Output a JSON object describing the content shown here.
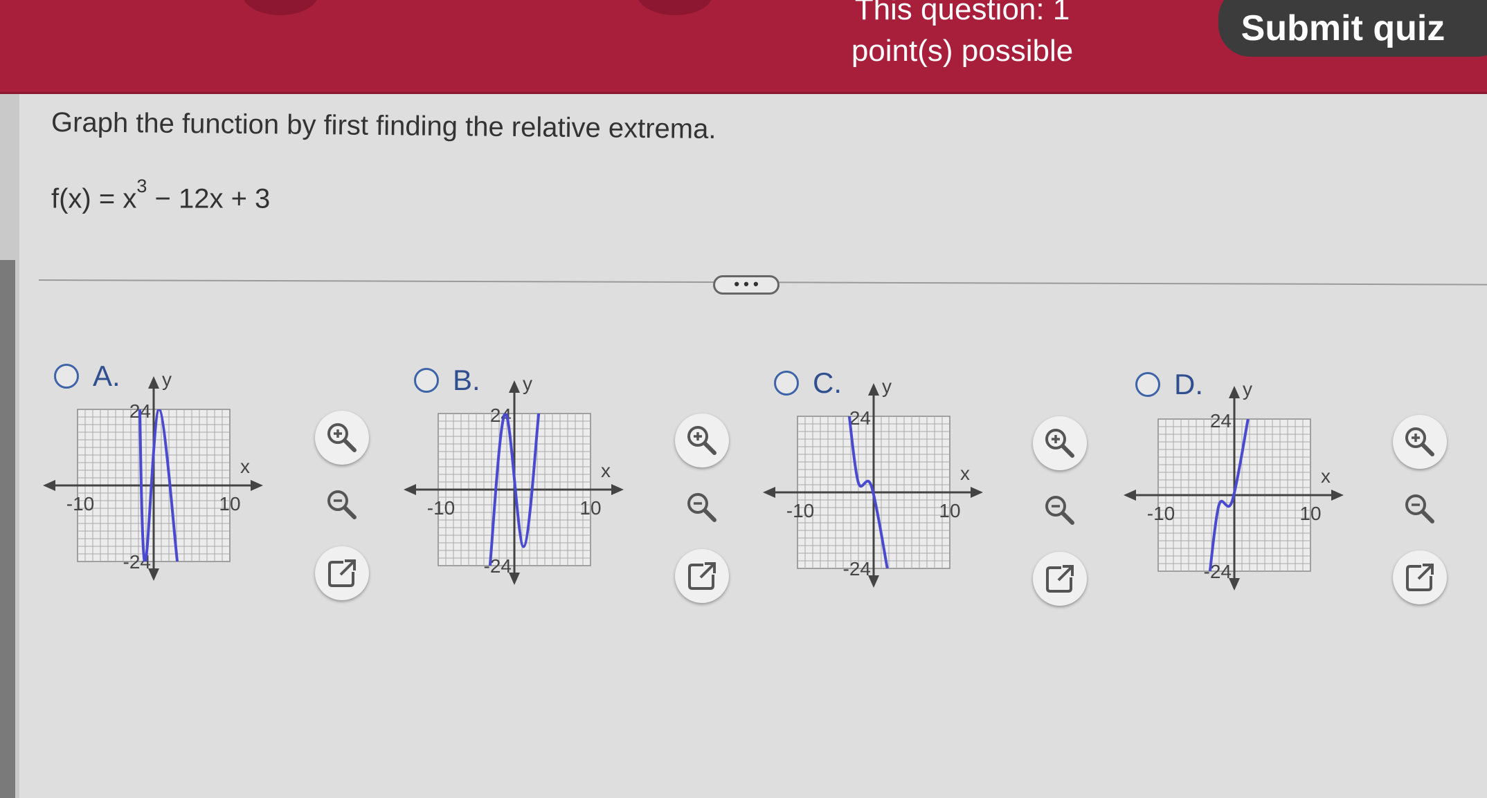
{
  "header": {
    "question_label": "This question: 1",
    "points_label": "point(s) possible",
    "submit_label": "Submit quiz"
  },
  "question": {
    "instruction": "Graph the function by first finding the relative extrema.",
    "formula_prefix": "f(x) = x",
    "formula_exponent": "3",
    "formula_suffix": " − 12x + 3"
  },
  "more_button": {
    "label": "• • •"
  },
  "options": [
    {
      "label": "A.",
      "curve": [
        [
          -2,
          50
        ],
        [
          -1.2,
          -24
        ],
        [
          0.7,
          24
        ],
        [
          3.1,
          -24
        ]
      ]
    },
    {
      "label": "B.",
      "curve": [
        [
          -3.2,
          -24
        ],
        [
          -1.2,
          24
        ],
        [
          1.2,
          -18
        ],
        [
          3.2,
          24
        ]
      ]
    },
    {
      "label": "C.",
      "curve": [
        [
          -3.2,
          24
        ],
        [
          -2,
          3
        ],
        [
          -0.3,
          2
        ],
        [
          1.8,
          -24
        ]
      ]
    },
    {
      "label": "D.",
      "curve": [
        [
          -3.2,
          -24
        ],
        [
          -2,
          -3
        ],
        [
          -0.3,
          -2
        ],
        [
          1.8,
          24
        ]
      ]
    }
  ],
  "graph_axes": {
    "x_label": "x",
    "y_label": "y",
    "x_min_label": "-10",
    "x_max_label": "10",
    "y_max_label": "24",
    "y_min_label": "-24",
    "xlim": [
      -10,
      10
    ],
    "ylim": [
      -24,
      24
    ]
  },
  "tools": {
    "zoom_in": "zoom-in-icon",
    "zoom_out": "zoom-out-icon",
    "open": "external-link-icon"
  },
  "colors": {
    "header": "#a81f3b",
    "curve": "#4a4ad0",
    "radio": "#3e64a8"
  }
}
